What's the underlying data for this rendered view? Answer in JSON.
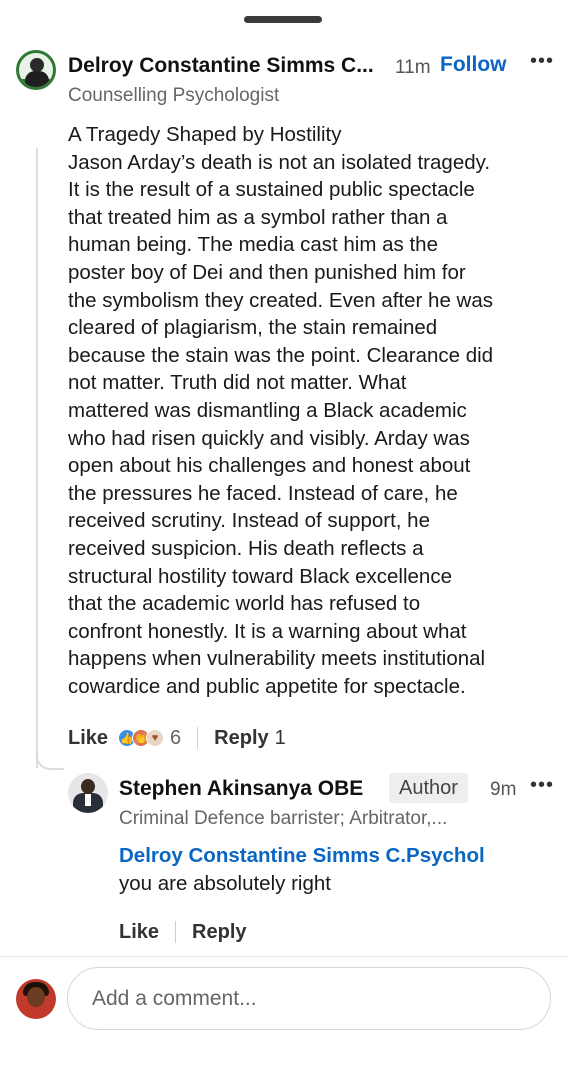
{
  "post_comment": {
    "author_name": "Delroy Constantine Simms C...",
    "time": "11m",
    "follow_label": "Follow",
    "more_icon": "more-horizontal-icon",
    "headline": "Counselling Psychologist",
    "body_lines": [
      "A Tragedy Shaped by Hostility",
      "Jason Arday’s death is not an isolated tragedy.",
      "It is the result of a sustained public spectacle",
      "that treated him as a symbol rather than a",
      "human being. The media cast him as the",
      "poster boy of Dei and then punished him for",
      "the symbolism they created. Even after he was",
      "cleared of plagiarism, the stain remained",
      "because the stain was the point. Clearance did",
      "not matter. Truth did not matter. What",
      "mattered was dismantling a Black academic",
      "who had risen quickly and visibly. Arday was",
      "open about his challenges and honest about",
      "the pressures he faced. Instead of care, he",
      "received scrutiny. Instead of support, he",
      "received suspicion. His death reflects a",
      "structural hostility toward Black excellence",
      "that the academic world has refused to",
      "confront honestly. It is a warning about what",
      "happens when vulnerability meets institutional",
      "cowardice and public appetite for spectacle."
    ],
    "like_label": "Like",
    "reaction_count": "6",
    "reply_label": "Reply",
    "reply_count": "1"
  },
  "reply_comment": {
    "author_name": "Stephen Akinsanya OBE",
    "badge": "Author",
    "time": "9m",
    "headline": "Criminal Defence barrister; Arbitrator,...",
    "mention": "Delroy Constantine Simms C.Psychol",
    "text": "you are absolutely right",
    "like_label": "Like",
    "reply_label": "Reply"
  },
  "composer": {
    "placeholder": "Add a comment..."
  },
  "colors": {
    "accent": "#0a66c2",
    "text": "#1a1a1a",
    "muted": "#666666"
  }
}
